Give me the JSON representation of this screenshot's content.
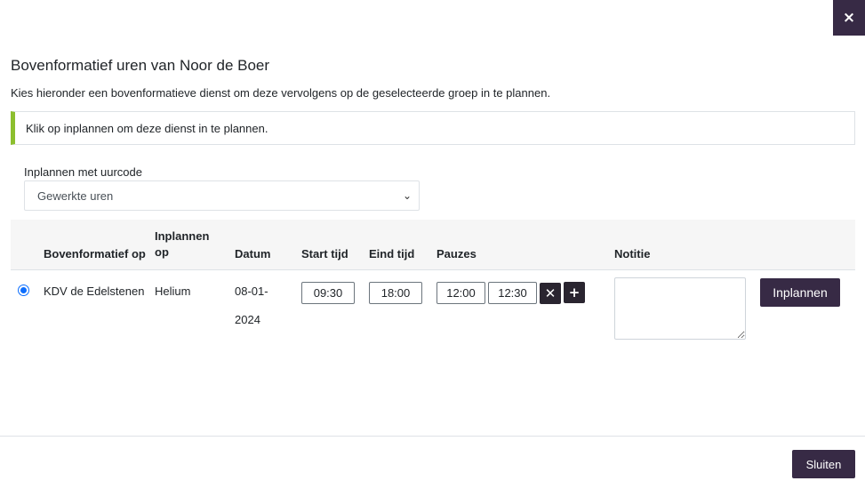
{
  "dialog": {
    "close_icon": "×",
    "title": "Bovenformatief uren van Noor de Boer",
    "subtitle": "Kies hieronder een bovenformatieve dienst om deze vervolgens op de geselecteerde groep in te plannen.",
    "info": "Klik op inplannen om deze dienst in te plannen."
  },
  "uurcode": {
    "label": "Inplannen met uurcode",
    "selected": "Gewerkte uren"
  },
  "table": {
    "headers": {
      "bovenformatief": "Bovenformatief op",
      "inplannen_line1": "Inplannen",
      "inplannen_line2": "op",
      "datum": "Datum",
      "start": "Start tijd",
      "eind": "Eind tijd",
      "pauzes": "Pauzes",
      "notitie": "Notitie"
    },
    "row": {
      "bovenformatief": "KDV de Edelstenen",
      "inplannen": "Helium",
      "datum_line1": "08-01-",
      "datum_line2": "2024",
      "start": "09:30",
      "eind": "18:00",
      "pauze_start": "12:00",
      "pauze_eind": "12:30",
      "remove_icon": "✕",
      "add_icon": "+",
      "notitie": "",
      "plan_button": "Inplannen"
    }
  },
  "footer": {
    "close_button": "Sluiten"
  },
  "colors": {
    "primary": "#372a45",
    "info_accent": "#8cbf2e",
    "radio": "#0d6efd"
  }
}
